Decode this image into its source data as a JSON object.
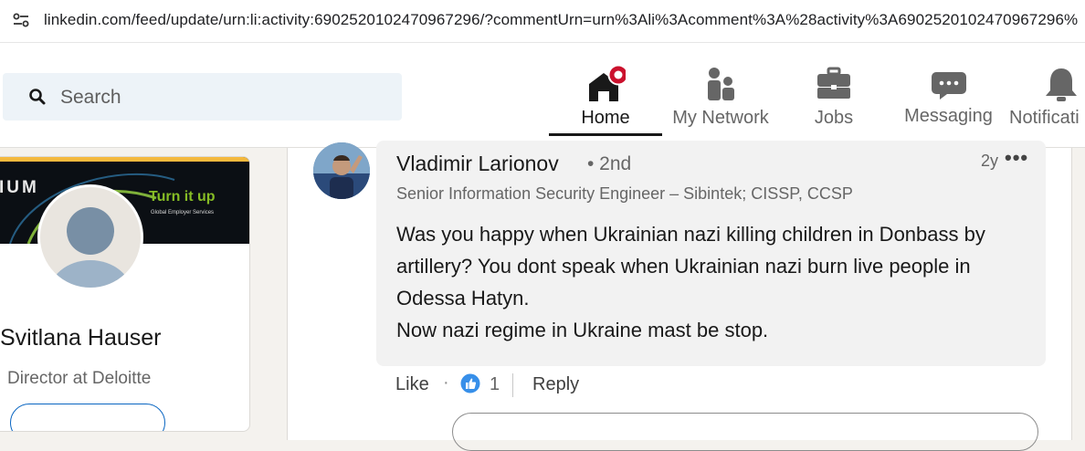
{
  "browser": {
    "url": "linkedin.com/feed/update/urn:li:activity:6902520102470967296/?commentUrn=urn%3Ali%3Acomment%3A%28activity%3A6902520102470967296%"
  },
  "nav": {
    "search_label": "Search",
    "items": [
      {
        "label": "Home",
        "icon": "home-icon"
      },
      {
        "label": "My Network",
        "icon": "network-icon"
      },
      {
        "label": "Jobs",
        "icon": "briefcase-icon"
      },
      {
        "label": "Messaging",
        "icon": "messaging-icon"
      },
      {
        "label": "Notificati",
        "icon": "bell-icon"
      }
    ],
    "accent": "#cb112d"
  },
  "profile": {
    "banner_text": "IUM",
    "banner_slogan": "Turn it up",
    "banner_sub": "Global Employer Services",
    "name": "Svitlana Hauser",
    "headline": "Director at Deloitte"
  },
  "comment": {
    "author": "Vladimir Larionov",
    "degree": "• 2nd",
    "headline": "Senior Information Security Engineer – Sibintek; CISSP, CCSP",
    "time": "2y",
    "more": "•••",
    "lines": [
      "Was you happy when Ukrainian nazi killing children in Donbass by artillery? You dont speak when Ukrainian nazi burn live people in Odessa Hatyn.",
      "Now nazi regime in Ukraine mast be stop."
    ],
    "actions": {
      "like": "Like",
      "dot": "·",
      "reaction_count": "1",
      "reply": "Reply"
    }
  },
  "colors": {
    "linkedin_blue": "#0a66c2",
    "deloitte_green": "#86bc25"
  }
}
